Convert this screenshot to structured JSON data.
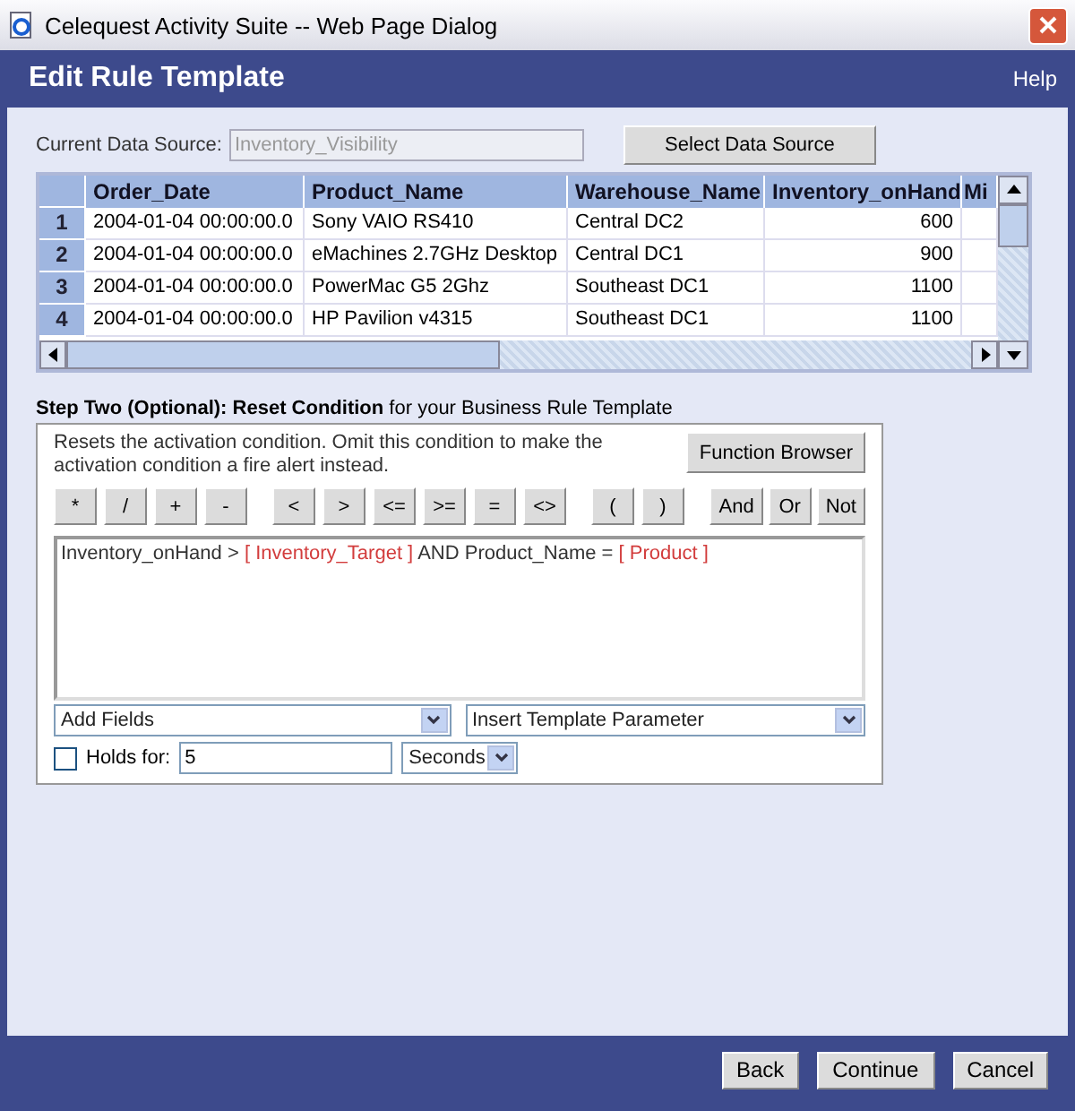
{
  "window": {
    "title": "Celequest Activity Suite -- Web Page Dialog"
  },
  "header": {
    "title": "Edit Rule Template",
    "help": "Help"
  },
  "data_source": {
    "label": "Current Data Source:",
    "value": "Inventory_Visibility",
    "button": "Select Data Source"
  },
  "table": {
    "columns": [
      "Order_Date",
      "Product_Name",
      "Warehouse_Name",
      "Inventory_onHand",
      "Mi"
    ],
    "rows": [
      {
        "number": "1",
        "cells": [
          "2004-01-04 00:00:00.0",
          "Sony VAIO RS410",
          "Central DC2",
          "600"
        ]
      },
      {
        "number": "2",
        "cells": [
          "2004-01-04 00:00:00.0",
          "eMachines 2.7GHz Desktop",
          "Central DC1",
          "900"
        ]
      },
      {
        "number": "3",
        "cells": [
          "2004-01-04 00:00:00.0",
          "PowerMac G5 2Ghz",
          "Southeast DC1",
          "1100"
        ]
      },
      {
        "number": "4",
        "cells": [
          "2004-01-04 00:00:00.0",
          "HP Pavilion v4315",
          "Southeast DC1",
          "1100"
        ]
      }
    ]
  },
  "step": {
    "heading": "**Step Two (Optional):  Reset Condition** for your Business Rule Template",
    "description": "Resets the activation condition. Omit this condition to make the activation condition a fire alert instead.",
    "function_browser": "Function Browser",
    "operator_groups": [
      [
        "*",
        "/",
        "+",
        "-"
      ],
      [
        "<",
        ">",
        "<=",
        ">=",
        "=",
        "<>"
      ],
      [
        "(",
        ")"
      ],
      [
        "And",
        "Or",
        "Not"
      ]
    ],
    "condition": [
      {
        "kind": "text",
        "text": "Inventory_onHand >"
      },
      {
        "kind": "param",
        "text": "[ Inventory_Target ]"
      },
      {
        "kind": "text",
        "text": "AND Product_Name ="
      },
      {
        "kind": "param",
        "text": "[ Product ]"
      }
    ],
    "add_fields": "Add Fields",
    "insert_parameter": "Insert Template Parameter",
    "holds": {
      "checked": false,
      "label": "Holds for:",
      "value": "5",
      "unit": "Seconds"
    }
  },
  "buttons": [
    "Back",
    "Continue",
    "Cancel"
  ]
}
